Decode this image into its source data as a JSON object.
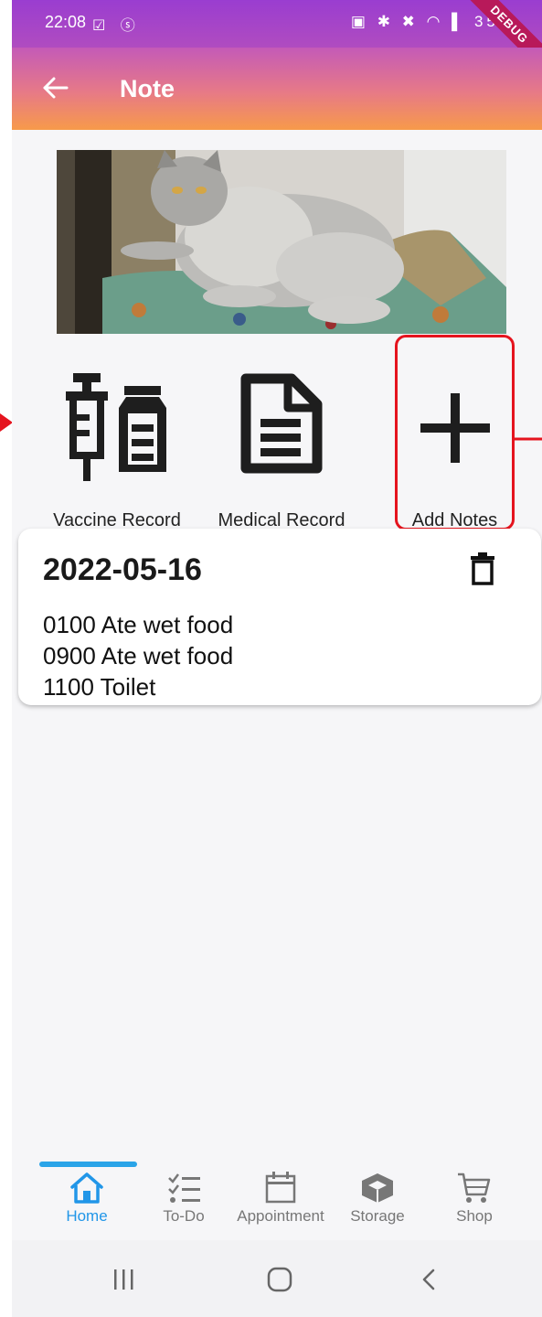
{
  "status_bar": {
    "time": "22:08",
    "left_icons": "☑ ⓢ",
    "right_icons": "▣ ✱ ✖ ◠ ▌",
    "battery": "35%",
    "debug_ribbon": "DEBUG"
  },
  "app_bar": {
    "title": "Note"
  },
  "actions": {
    "vaccine": "Vaccine Record",
    "medical": "Medical Record",
    "add": "Add Notes"
  },
  "note": {
    "date": "2022-05-16",
    "lines": [
      "0100 Ate wet food",
      "0900 Ate wet food",
      "1100 Toilet"
    ]
  },
  "bottom_nav": {
    "items": [
      {
        "label": "Home",
        "icon": "home-icon",
        "active": true
      },
      {
        "label": "To-Do",
        "icon": "checklist-icon",
        "active": false
      },
      {
        "label": "Appointment",
        "icon": "calendar-icon",
        "active": false
      },
      {
        "label": "Storage",
        "icon": "box-icon",
        "active": false
      },
      {
        "label": "Shop",
        "icon": "cart-icon",
        "active": false
      }
    ]
  },
  "colors": {
    "accent": "#2196e8",
    "highlight": "#e5141e",
    "appbar_top": "#c45ab8",
    "appbar_bottom": "#f79a4a"
  }
}
